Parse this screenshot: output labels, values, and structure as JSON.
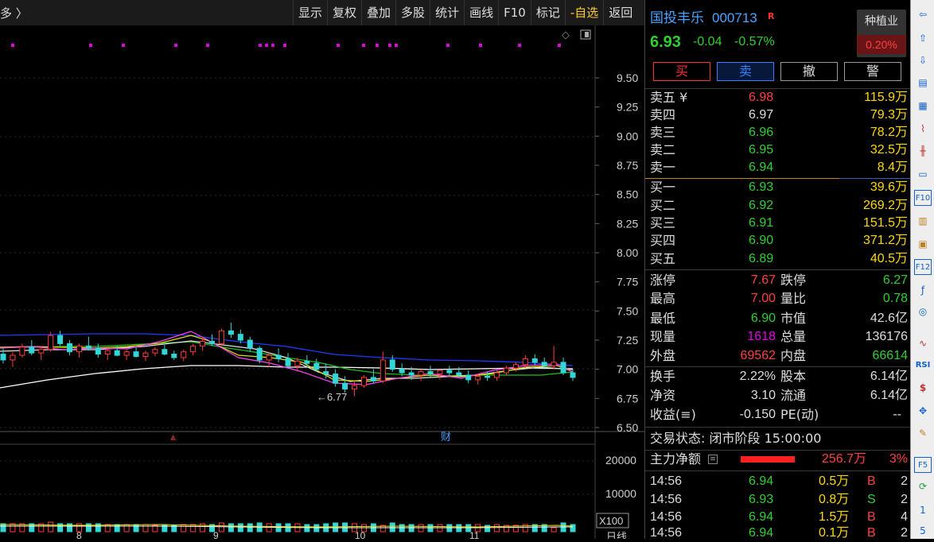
{
  "crumb": "多 〉",
  "toolbar": {
    "items": [
      "显示",
      "复权",
      "叠加",
      "多股",
      "统计",
      "画线",
      "F10",
      "标记",
      "-自选",
      "返回"
    ]
  },
  "stock": {
    "name": "国投丰乐",
    "code": "000713",
    "badge": "R",
    "price": "6.93",
    "change": "-0.04",
    "pct": "-0.57%",
    "sector": "种植业",
    "sector_pct": "0.20%"
  },
  "actions": {
    "buy": "买",
    "sell": "卖",
    "cancel": "撤",
    "alert": "警"
  },
  "orderbook": {
    "asks": [
      {
        "label": "卖五 ¥",
        "price": "6.98",
        "vol": "115.9万"
      },
      {
        "label": "卖四",
        "price": "6.97",
        "vol": "79.3万"
      },
      {
        "label": "卖三",
        "price": "6.96",
        "vol": "78.2万"
      },
      {
        "label": "卖二",
        "price": "6.95",
        "vol": "32.5万"
      },
      {
        "label": "卖一",
        "price": "6.94",
        "vol": "8.4万"
      }
    ],
    "bids": [
      {
        "label": "买一",
        "price": "6.93",
        "vol": "39.6万"
      },
      {
        "label": "买二",
        "price": "6.92",
        "vol": "269.2万"
      },
      {
        "label": "买三",
        "price": "6.91",
        "vol": "151.5万"
      },
      {
        "label": "买四",
        "price": "6.90",
        "vol": "371.2万"
      },
      {
        "label": "买五",
        "price": "6.89",
        "vol": "40.5万"
      }
    ]
  },
  "stats": [
    {
      "l1": "涨停",
      "v1": "7.67",
      "l2": "跌停",
      "v2": "6.27"
    },
    {
      "l1": "最高",
      "v1": "7.00",
      "l2": "量比",
      "v2": "0.78"
    },
    {
      "l1": "最低",
      "v1": "6.90",
      "l2": "市值",
      "v2": "42.6亿"
    },
    {
      "l1": "现量",
      "v1": "1618",
      "l2": "总量",
      "v2": "136176"
    },
    {
      "l1": "外盘",
      "v1": "69562",
      "l2": "内盘",
      "v2": "66614"
    },
    {
      "l1": "换手",
      "v1": "2.22%",
      "l2": "股本",
      "v2": "6.14亿"
    },
    {
      "l1": "净资",
      "v1": "3.10",
      "l2": "流通",
      "v2": "6.14亿"
    },
    {
      "l1": "收益(≡)",
      "v1": "-0.150",
      "l2": "PE(动)",
      "v2": "--"
    }
  ],
  "status": "交易状态: 闭市阶段 15:00:00",
  "capital": {
    "label": "主力净额",
    "value": "256.7万",
    "pct": "3%"
  },
  "ticks": [
    {
      "time": "14:56",
      "price": "6.94",
      "vol": "0.5万",
      "side": "B",
      "n": "2"
    },
    {
      "time": "14:56",
      "price": "6.93",
      "vol": "0.8万",
      "side": "S",
      "n": "2"
    },
    {
      "time": "14:56",
      "price": "6.94",
      "vol": "1.5万",
      "side": "B",
      "n": "4"
    },
    {
      "time": "14:56",
      "price": "6.94",
      "vol": "0.1万",
      "side": "B",
      "n": "2"
    }
  ],
  "chart": {
    "y_ticks": [
      "9.50",
      "9.25",
      "9.00",
      "8.75",
      "8.50",
      "8.25",
      "8.00",
      "7.75",
      "7.50",
      "7.25",
      "7.00",
      "6.75",
      "6.50"
    ],
    "low_label": "←6.77",
    "fin_label": "财",
    "vol_ticks": [
      "20000",
      "10000"
    ],
    "vol_unit": "X100",
    "month_labels": [
      "8",
      "9",
      "10",
      "11"
    ],
    "period_label": "日线"
  },
  "chart_data": {
    "type": "candlestick",
    "ylim": [
      6.5,
      9.6
    ],
    "y_ticks": [
      9.5,
      9.25,
      9.0,
      8.75,
      8.5,
      8.25,
      8.0,
      7.75,
      7.5,
      7.25,
      7.0,
      6.75,
      6.5
    ],
    "last_close": 6.93,
    "period_low": 6.77,
    "ohlc": [
      [
        7.13,
        7.18,
        7.05,
        7.08
      ],
      [
        7.08,
        7.15,
        7.02,
        7.12
      ],
      [
        7.12,
        7.22,
        7.1,
        7.19
      ],
      [
        7.19,
        7.25,
        7.12,
        7.14
      ],
      [
        7.14,
        7.2,
        7.08,
        7.17
      ],
      [
        7.17,
        7.32,
        7.15,
        7.29
      ],
      [
        7.29,
        7.33,
        7.2,
        7.22
      ],
      [
        7.22,
        7.25,
        7.12,
        7.15
      ],
      [
        7.15,
        7.22,
        7.1,
        7.2
      ],
      [
        7.2,
        7.28,
        7.16,
        7.18
      ],
      [
        7.18,
        7.22,
        7.1,
        7.13
      ],
      [
        7.13,
        7.18,
        7.08,
        7.16
      ],
      [
        7.16,
        7.2,
        7.11,
        7.12
      ],
      [
        7.12,
        7.17,
        7.08,
        7.15
      ],
      [
        7.15,
        7.19,
        7.1,
        7.11
      ],
      [
        7.11,
        7.16,
        7.07,
        7.14
      ],
      [
        7.14,
        7.19,
        7.11,
        7.17
      ],
      [
        7.17,
        7.21,
        7.12,
        7.13
      ],
      [
        7.13,
        7.16,
        7.08,
        7.1
      ],
      [
        7.1,
        7.17,
        7.07,
        7.15
      ],
      [
        7.15,
        7.22,
        7.12,
        7.2
      ],
      [
        7.2,
        7.28,
        7.16,
        7.24
      ],
      [
        7.24,
        7.3,
        7.2,
        7.22
      ],
      [
        7.22,
        7.35,
        7.2,
        7.33
      ],
      [
        7.33,
        7.4,
        7.27,
        7.3
      ],
      [
        7.3,
        7.34,
        7.22,
        7.25
      ],
      [
        7.25,
        7.28,
        7.15,
        7.18
      ],
      [
        7.18,
        7.2,
        7.05,
        7.08
      ],
      [
        7.08,
        7.15,
        7.02,
        7.12
      ],
      [
        7.12,
        7.18,
        7.06,
        7.09
      ],
      [
        7.09,
        7.14,
        7.01,
        7.03
      ],
      [
        7.03,
        7.1,
        6.98,
        7.07
      ],
      [
        7.07,
        7.12,
        7.02,
        7.05
      ],
      [
        7.05,
        7.09,
        6.98,
        7.0
      ],
      [
        6.98,
        7.05,
        6.92,
        6.96
      ],
      [
        6.96,
        7.0,
        6.85,
        6.88
      ],
      [
        6.88,
        6.94,
        6.8,
        6.83
      ],
      [
        6.83,
        6.9,
        6.77,
        6.86
      ],
      [
        6.86,
        6.95,
        6.84,
        6.93
      ],
      [
        6.93,
        7.0,
        6.88,
        6.9
      ],
      [
        6.9,
        7.15,
        6.88,
        7.08
      ],
      [
        7.08,
        7.12,
        6.98,
        7.0
      ],
      [
        7.0,
        7.05,
        6.94,
        6.97
      ],
      [
        6.97,
        7.02,
        6.91,
        6.95
      ],
      [
        6.95,
        7.0,
        6.9,
        6.98
      ],
      [
        6.98,
        7.03,
        6.93,
        6.96
      ],
      [
        6.96,
        7.0,
        6.91,
        6.99
      ],
      [
        6.99,
        7.03,
        6.94,
        6.97
      ],
      [
        6.97,
        7.02,
        6.93,
        6.95
      ],
      [
        6.95,
        6.99,
        6.88,
        6.91
      ],
      [
        6.91,
        6.96,
        6.87,
        6.94
      ],
      [
        6.94,
        6.98,
        6.9,
        6.93
      ],
      [
        6.93,
        6.99,
        6.9,
        6.97
      ],
      [
        6.97,
        7.03,
        6.95,
        7.01
      ],
      [
        7.01,
        7.06,
        6.98,
        7.04
      ],
      [
        7.04,
        7.12,
        7.01,
        7.09
      ],
      [
        7.09,
        7.13,
        7.03,
        7.06
      ],
      [
        7.06,
        7.1,
        7.0,
        7.03
      ],
      [
        7.03,
        7.2,
        7.0,
        7.06
      ],
      [
        7.06,
        7.1,
        6.95,
        6.97
      ],
      [
        6.97,
        7.0,
        6.9,
        6.93
      ]
    ]
  },
  "icons": [
    "back-arrow",
    "up-arrow",
    "down-arrow",
    "f10-info",
    "table",
    "line-chart",
    "candle",
    "list",
    "F10",
    "F11",
    "F12-doc",
    "F12",
    "fx",
    "circle",
    "",
    "wave",
    "RSI",
    "S",
    "move",
    "pencil",
    "",
    "F5",
    "refresh",
    "1",
    "5"
  ]
}
